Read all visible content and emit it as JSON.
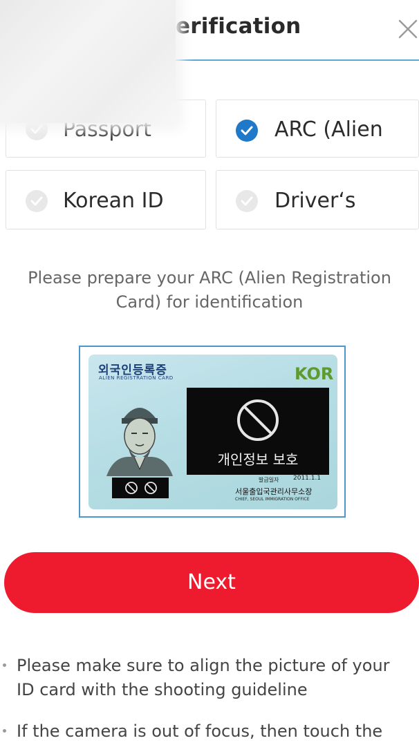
{
  "header": {
    "title": "erification",
    "close_icon": "close-icon"
  },
  "id_options": [
    {
      "label": "Passport",
      "selected": false
    },
    {
      "label": "ARC (Alien",
      "selected": true
    },
    {
      "label": "Korean ID",
      "selected": false
    },
    {
      "label": "Driver‘s",
      "selected": false
    }
  ],
  "instruction": {
    "line1": "Please prepare your ARC (Alien Registration",
    "line2": "Card) for identification"
  },
  "sample_card": {
    "title": "외국인등록증",
    "subtitle": "ALIEN REGISTRATION CARD",
    "country": "KOR",
    "privacy_text": "개인정보 보호",
    "date_label": "발급일자",
    "issue_date": "2011.1.1",
    "issuer": "서울출입국관리사무소장",
    "issuer_en": "CHIEF, SEOUL IMMIGRATION OFFICE"
  },
  "next_button": {
    "label": "Next"
  },
  "notes": [
    {
      "line1": "Please make sure to align the picture of your",
      "line2": "ID card with the shooting guideline"
    },
    {
      "line1": "If the camera is out of focus, then touch the"
    }
  ],
  "colors": {
    "accent_blue": "#1f78c8",
    "next_red": "#ee1b2e",
    "frame_blue": "#4a97cc",
    "kor_green": "#5d9a2f"
  }
}
